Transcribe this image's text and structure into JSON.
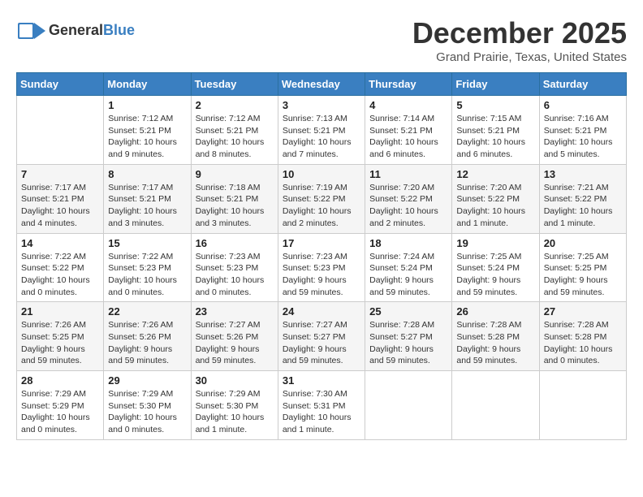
{
  "logo": {
    "text_general": "General",
    "text_blue": "Blue"
  },
  "header": {
    "month": "December 2025",
    "location": "Grand Prairie, Texas, United States"
  },
  "days_of_week": [
    "Sunday",
    "Monday",
    "Tuesday",
    "Wednesday",
    "Thursday",
    "Friday",
    "Saturday"
  ],
  "weeks": [
    [
      {
        "day": "",
        "info": ""
      },
      {
        "day": "1",
        "info": "Sunrise: 7:12 AM\nSunset: 5:21 PM\nDaylight: 10 hours\nand 9 minutes."
      },
      {
        "day": "2",
        "info": "Sunrise: 7:12 AM\nSunset: 5:21 PM\nDaylight: 10 hours\nand 8 minutes."
      },
      {
        "day": "3",
        "info": "Sunrise: 7:13 AM\nSunset: 5:21 PM\nDaylight: 10 hours\nand 7 minutes."
      },
      {
        "day": "4",
        "info": "Sunrise: 7:14 AM\nSunset: 5:21 PM\nDaylight: 10 hours\nand 6 minutes."
      },
      {
        "day": "5",
        "info": "Sunrise: 7:15 AM\nSunset: 5:21 PM\nDaylight: 10 hours\nand 6 minutes."
      },
      {
        "day": "6",
        "info": "Sunrise: 7:16 AM\nSunset: 5:21 PM\nDaylight: 10 hours\nand 5 minutes."
      }
    ],
    [
      {
        "day": "7",
        "info": "Sunrise: 7:17 AM\nSunset: 5:21 PM\nDaylight: 10 hours\nand 4 minutes."
      },
      {
        "day": "8",
        "info": "Sunrise: 7:17 AM\nSunset: 5:21 PM\nDaylight: 10 hours\nand 3 minutes."
      },
      {
        "day": "9",
        "info": "Sunrise: 7:18 AM\nSunset: 5:21 PM\nDaylight: 10 hours\nand 3 minutes."
      },
      {
        "day": "10",
        "info": "Sunrise: 7:19 AM\nSunset: 5:22 PM\nDaylight: 10 hours\nand 2 minutes."
      },
      {
        "day": "11",
        "info": "Sunrise: 7:20 AM\nSunset: 5:22 PM\nDaylight: 10 hours\nand 2 minutes."
      },
      {
        "day": "12",
        "info": "Sunrise: 7:20 AM\nSunset: 5:22 PM\nDaylight: 10 hours\nand 1 minute."
      },
      {
        "day": "13",
        "info": "Sunrise: 7:21 AM\nSunset: 5:22 PM\nDaylight: 10 hours\nand 1 minute."
      }
    ],
    [
      {
        "day": "14",
        "info": "Sunrise: 7:22 AM\nSunset: 5:22 PM\nDaylight: 10 hours\nand 0 minutes."
      },
      {
        "day": "15",
        "info": "Sunrise: 7:22 AM\nSunset: 5:23 PM\nDaylight: 10 hours\nand 0 minutes."
      },
      {
        "day": "16",
        "info": "Sunrise: 7:23 AM\nSunset: 5:23 PM\nDaylight: 10 hours\nand 0 minutes."
      },
      {
        "day": "17",
        "info": "Sunrise: 7:23 AM\nSunset: 5:23 PM\nDaylight: 9 hours\nand 59 minutes."
      },
      {
        "day": "18",
        "info": "Sunrise: 7:24 AM\nSunset: 5:24 PM\nDaylight: 9 hours\nand 59 minutes."
      },
      {
        "day": "19",
        "info": "Sunrise: 7:25 AM\nSunset: 5:24 PM\nDaylight: 9 hours\nand 59 minutes."
      },
      {
        "day": "20",
        "info": "Sunrise: 7:25 AM\nSunset: 5:25 PM\nDaylight: 9 hours\nand 59 minutes."
      }
    ],
    [
      {
        "day": "21",
        "info": "Sunrise: 7:26 AM\nSunset: 5:25 PM\nDaylight: 9 hours\nand 59 minutes."
      },
      {
        "day": "22",
        "info": "Sunrise: 7:26 AM\nSunset: 5:26 PM\nDaylight: 9 hours\nand 59 minutes."
      },
      {
        "day": "23",
        "info": "Sunrise: 7:27 AM\nSunset: 5:26 PM\nDaylight: 9 hours\nand 59 minutes."
      },
      {
        "day": "24",
        "info": "Sunrise: 7:27 AM\nSunset: 5:27 PM\nDaylight: 9 hours\nand 59 minutes."
      },
      {
        "day": "25",
        "info": "Sunrise: 7:28 AM\nSunset: 5:27 PM\nDaylight: 9 hours\nand 59 minutes."
      },
      {
        "day": "26",
        "info": "Sunrise: 7:28 AM\nSunset: 5:28 PM\nDaylight: 9 hours\nand 59 minutes."
      },
      {
        "day": "27",
        "info": "Sunrise: 7:28 AM\nSunset: 5:28 PM\nDaylight: 10 hours\nand 0 minutes."
      }
    ],
    [
      {
        "day": "28",
        "info": "Sunrise: 7:29 AM\nSunset: 5:29 PM\nDaylight: 10 hours\nand 0 minutes."
      },
      {
        "day": "29",
        "info": "Sunrise: 7:29 AM\nSunset: 5:30 PM\nDaylight: 10 hours\nand 0 minutes."
      },
      {
        "day": "30",
        "info": "Sunrise: 7:29 AM\nSunset: 5:30 PM\nDaylight: 10 hours\nand 1 minute."
      },
      {
        "day": "31",
        "info": "Sunrise: 7:30 AM\nSunset: 5:31 PM\nDaylight: 10 hours\nand 1 minute."
      },
      {
        "day": "",
        "info": ""
      },
      {
        "day": "",
        "info": ""
      },
      {
        "day": "",
        "info": ""
      }
    ]
  ]
}
